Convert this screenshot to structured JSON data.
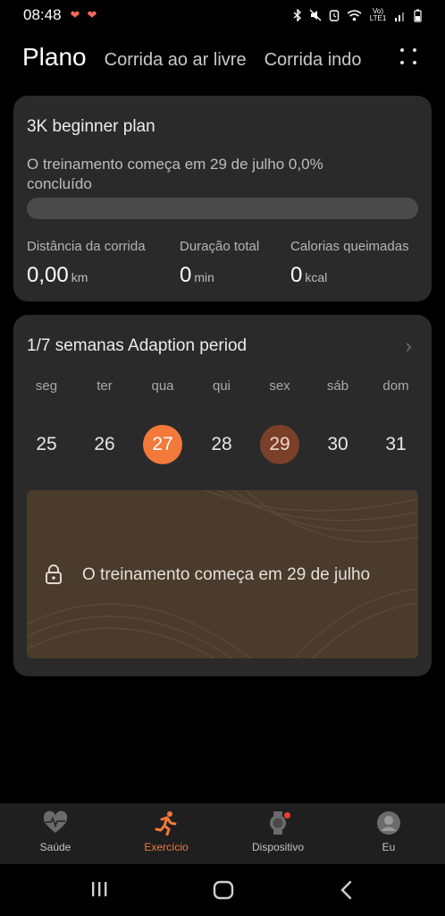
{
  "status_bar": {
    "time": "08:48",
    "network_label": "Vo) LTE1"
  },
  "header": {
    "tabs": [
      {
        "label": "Plano",
        "active": true
      },
      {
        "label": "Corrida ao ar livre",
        "active": false
      },
      {
        "label": "Corrida indo",
        "active": false
      }
    ]
  },
  "plan_card": {
    "title": "3K beginner plan",
    "status": "O treinamento começa em 29 de julho 0,0% concluído",
    "progress_fraction": 0.0,
    "stats": [
      {
        "label": "Distância da corrida",
        "value": "0,00",
        "unit": "km"
      },
      {
        "label": "Duração total",
        "value": "0",
        "unit": "min"
      },
      {
        "label": "Calorias queimadas",
        "value": "0",
        "unit": "kcal"
      }
    ]
  },
  "week_card": {
    "title": "1/7 semanas Adaption period",
    "days": [
      "seg",
      "ter",
      "qua",
      "qui",
      "sex",
      "sáb",
      "dom"
    ],
    "dates": [
      "25",
      "26",
      "27",
      "28",
      "29",
      "30",
      "31"
    ],
    "today_index": 2,
    "start_index": 4,
    "locked_message": "O treinamento começa em 29 de julho"
  },
  "bottom_nav": {
    "items": [
      {
        "label": "Saúde",
        "icon": "heart-pulse-icon",
        "active": false
      },
      {
        "label": "Exercício",
        "icon": "running-icon",
        "active": true
      },
      {
        "label": "Dispositivo",
        "icon": "watch-icon",
        "active": false
      },
      {
        "label": "Eu",
        "icon": "user-avatar-icon",
        "active": false
      }
    ]
  },
  "colors": {
    "accent": "#f2793a",
    "card_background": "#2a2a2a",
    "locked_banner": "#4b3b2c"
  }
}
